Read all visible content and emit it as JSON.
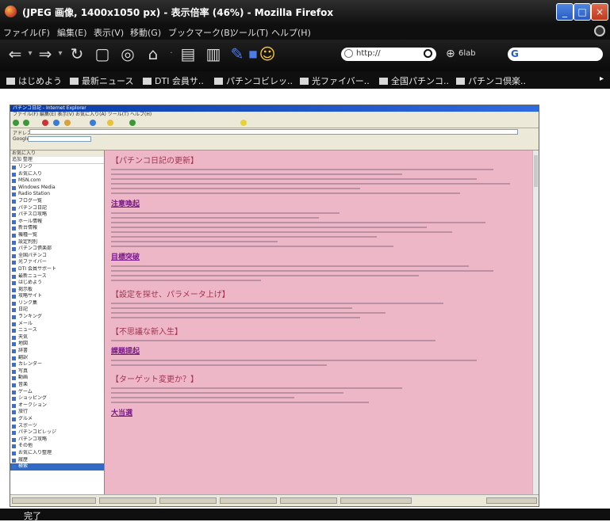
{
  "window": {
    "title": "(JPEG 画像, 1400x1050 px) - 表示倍率 (46%) - Mozilla Firefox",
    "buttons": {
      "minimize": "_",
      "maximize": "□",
      "close": "×"
    }
  },
  "menu": [
    "ファイル(F)",
    "編集(E)",
    "表示(V)",
    "移動(G)",
    "ブックマーク(B)",
    "ツール(T)",
    "ヘルプ(H)"
  ],
  "navbar": {
    "url_placeholder": "http://",
    "zoom_label": "6lab",
    "search_engine": "G"
  },
  "bookmarks": [
    "はじめよう",
    "最新ニュース",
    "DTI 会員サ..",
    "パチンコビレッ..",
    "光ファイバー..",
    "全国パチンコ..",
    "パチンコ倶楽.."
  ],
  "inner": {
    "title": "パチンコ日記 - Internet Explorer",
    "menu": "ファイル(F)  編集(E)  表示(V)  お気に入り(A)  ツール(T)  ヘルプ(H)",
    "address_label": "アドレス",
    "google_label": "Google",
    "sidebar_header": "お気に入り",
    "sidebar_header2": "追加  整理",
    "sidebar_items": [
      "リンク",
      "お気に入り",
      "MSN.com",
      "Windows Media",
      "Radio Station",
      "ブログ一覧",
      "パチンコ日記",
      "パチスロ攻略",
      "ホール情報",
      "新台情報",
      "機種一覧",
      "設定判別",
      "パチンコ倶楽部",
      "全国パチンコ",
      "光ファイバー",
      "DTI 会員サポート",
      "最新ニュース",
      "はじめよう",
      "掲示板",
      "攻略サイト",
      "リンク集",
      "日記",
      "ランキング",
      "メール",
      "ニュース",
      "天気",
      "地図",
      "辞書",
      "翻訳",
      "カレンダー",
      "写真",
      "動画",
      "音楽",
      "ゲーム",
      "ショッピング",
      "オークション",
      "旅行",
      "グルメ",
      "スポーツ",
      "パチンコビレッジ",
      "パチンコ攻略",
      "その他",
      "お気に入り整理",
      "履歴",
      "検索"
    ],
    "sections": [
      "【パチンコ日記の更新】",
      "【設定を探せ、パラメータ上げ】",
      "【不思議な新入生】",
      "【ターゲット変更か？】"
    ],
    "highlights": [
      "注意喚起",
      "目標突破",
      "課題提起",
      "大当選"
    ],
    "status_text": "完了"
  },
  "status": "完了"
}
